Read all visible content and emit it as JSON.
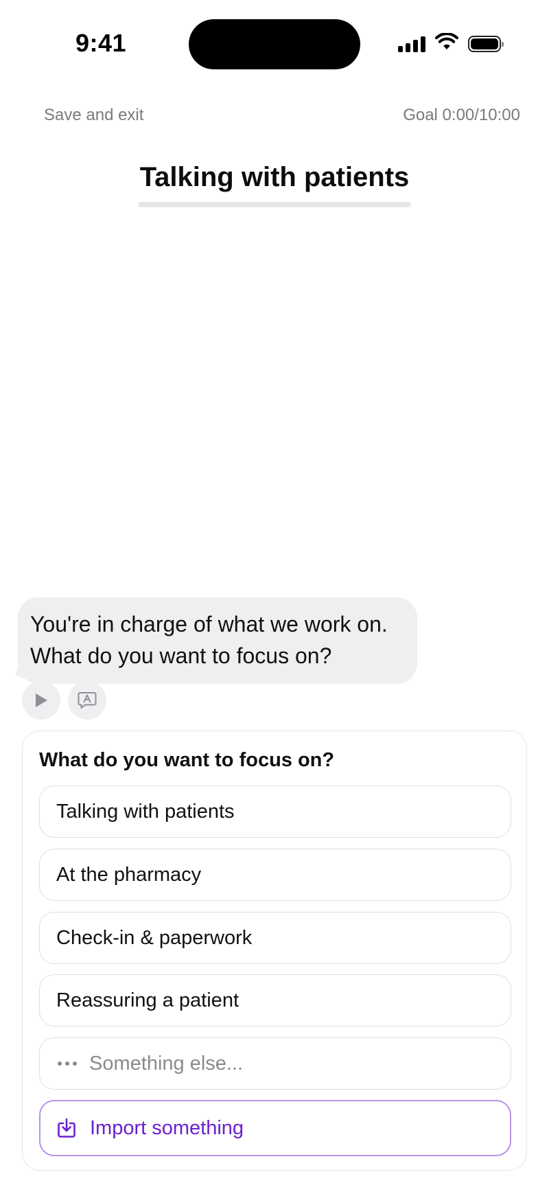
{
  "status_bar": {
    "time": "9:41"
  },
  "header": {
    "save_exit_label": "Save and exit",
    "goal_text": "Goal 0:00/10:00",
    "title": "Talking with patients",
    "progress": 0
  },
  "chat": {
    "message_lines": [
      "You're in charge of what we work on.",
      "What do you want to focus on?"
    ]
  },
  "focus_card": {
    "question": "What do you want to focus on?",
    "options": [
      "Talking with patients",
      "At the pharmacy",
      "Check-in & paperwork",
      "Reassuring a patient"
    ],
    "something_else_placeholder": "Something else...",
    "import_label": "Import something"
  },
  "colors": {
    "accent": "#6a1fd0",
    "accent_border": "#b892ec",
    "bubble_bg": "#efeff1",
    "muted_text": "#7a7a7a"
  },
  "icons": {
    "play": "play-icon",
    "translate": "translate-icon",
    "more": "dots-icon",
    "import": "import-icon"
  }
}
